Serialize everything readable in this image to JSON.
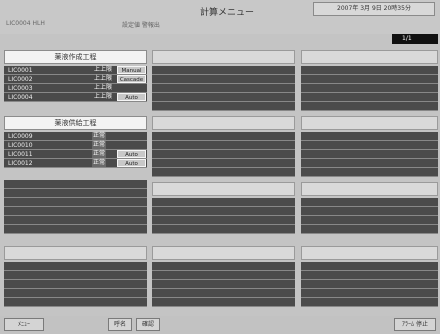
{
  "header": {
    "title": "計算メニュー",
    "datetime": "2007年 3月 9日 20時35分",
    "status_code": "LIC0004 HLH",
    "status_text": "設定値 警報出",
    "page_indicator": "1/1"
  },
  "panels": [
    {
      "title": "薬液作成工程",
      "rows": [
        {
          "tag": "LIC0001",
          "status": "上上限",
          "mode": "Manual"
        },
        {
          "tag": "LIC0002",
          "status": "上上限",
          "mode": "Cascade"
        },
        {
          "tag": "LIC0003",
          "status": "上上限",
          "mode": ""
        },
        {
          "tag": "LIC0004",
          "status": "上上限",
          "mode": "Auto"
        }
      ]
    },
    {
      "title": "薬液供給工程",
      "rows": [
        {
          "tag": "LIC0009",
          "status": "正常",
          "mode": ""
        },
        {
          "tag": "LIC0010",
          "status": "正常",
          "mode": ""
        },
        {
          "tag": "LIC0011",
          "status": "正常",
          "mode": "Auto"
        },
        {
          "tag": "LIC0012",
          "status": "正常",
          "mode": "Auto"
        }
      ]
    }
  ],
  "footer": {
    "menu_button": "ﾒﾆｭｰ",
    "name_button": "呼名",
    "hold_button": "確認",
    "ack_button": "ｱﾗｰﾑ 停止"
  }
}
